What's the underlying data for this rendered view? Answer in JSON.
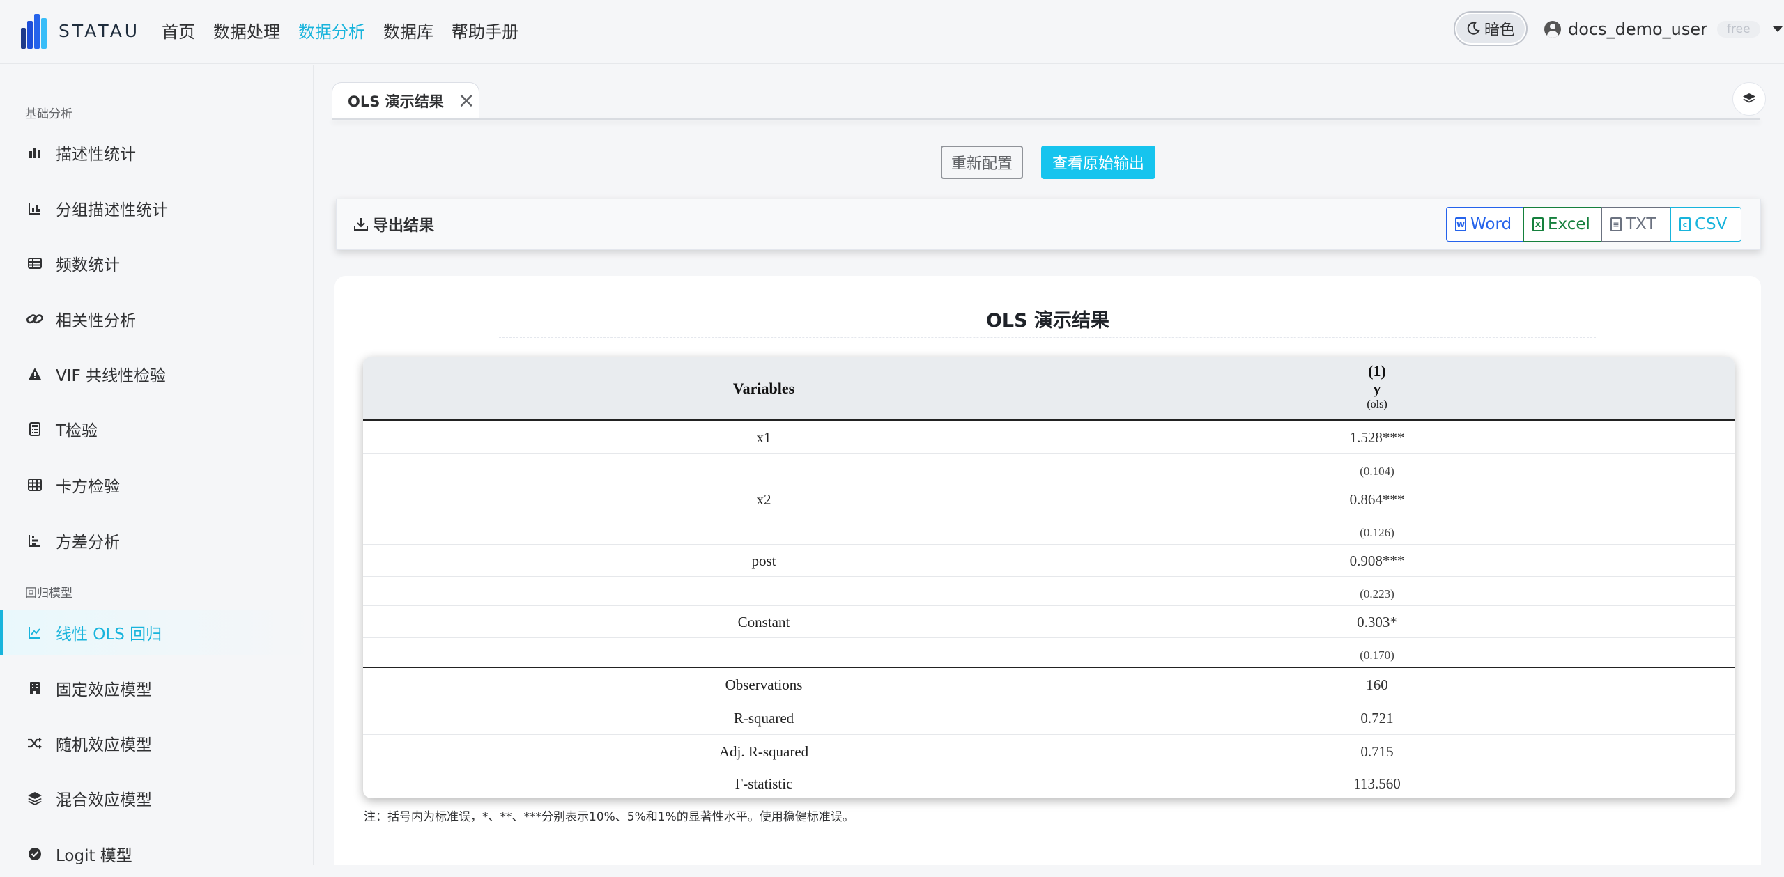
{
  "app": {
    "logo_text": "STATAU"
  },
  "nav": [
    {
      "label": "首页",
      "active": false
    },
    {
      "label": "数据处理",
      "active": false
    },
    {
      "label": "数据分析",
      "active": true
    },
    {
      "label": "数据库",
      "active": false
    },
    {
      "label": "帮助手册",
      "active": false
    }
  ],
  "header": {
    "theme_label": "暗色",
    "username": "docs_demo_user",
    "plan_badge": "free"
  },
  "sidebar": {
    "group_basic": "基础分析",
    "group_regression": "回归模型",
    "items": [
      {
        "label": "描述性统计",
        "icon": "bar-chart-icon"
      },
      {
        "label": "分组描述性统计",
        "icon": "column-chart-icon"
      },
      {
        "label": "频数统计",
        "icon": "table-list-icon"
      },
      {
        "label": "相关性分析",
        "icon": "link-icon"
      },
      {
        "label": "VIF 共线性检验",
        "icon": "warning-icon"
      },
      {
        "label": "T检验",
        "icon": "calculator-icon"
      },
      {
        "label": "卡方检验",
        "icon": "grid-icon"
      },
      {
        "label": "方差分析",
        "icon": "chart-bars-icon"
      },
      {
        "label": "线性 OLS 回归",
        "icon": "line-chart-icon",
        "active": true
      },
      {
        "label": "固定效应模型",
        "icon": "building-icon"
      },
      {
        "label": "随机效应模型",
        "icon": "shuffle-icon"
      },
      {
        "label": "混合效应模型",
        "icon": "layers-icon"
      },
      {
        "label": "Logit 模型",
        "icon": "check-circle-icon"
      }
    ]
  },
  "tab": {
    "label": "OLS 演示结果"
  },
  "actions": {
    "reconfigure": "重新配置",
    "view_raw": "查看原始输出"
  },
  "export": {
    "title": "导出结果",
    "word": "Word",
    "excel": "Excel",
    "txt": "TXT",
    "csv": "CSV"
  },
  "result": {
    "title": "OLS 演示结果",
    "header": {
      "variables": "Variables",
      "col_num": "(1)",
      "col_dep": "y",
      "col_model": "(ols)"
    },
    "rows": [
      {
        "var": "x1",
        "coef": "1.528***",
        "se": "(0.104)"
      },
      {
        "var": "x2",
        "coef": "0.864***",
        "se": "(0.126)"
      },
      {
        "var": "post",
        "coef": "0.908***",
        "se": "(0.223)"
      },
      {
        "var": "Constant",
        "coef": "0.303*",
        "se": "(0.170)"
      }
    ],
    "stats": [
      {
        "label": "Observations",
        "value": "160"
      },
      {
        "label": "R-squared",
        "value": "0.721"
      },
      {
        "label": "Adj. R-squared",
        "value": "0.715"
      },
      {
        "label": "F-statistic",
        "value": "113.560"
      }
    ],
    "note": "注：括号内为标准误，*、**、***分别表示10%、5%和1%的显著性水平。使用稳健标准误。"
  },
  "colors": {
    "accent": "#18b4dc",
    "primary_button": "#16c4ee",
    "word": "#2563eb",
    "excel": "#15803d",
    "txt": "#6b7280"
  }
}
